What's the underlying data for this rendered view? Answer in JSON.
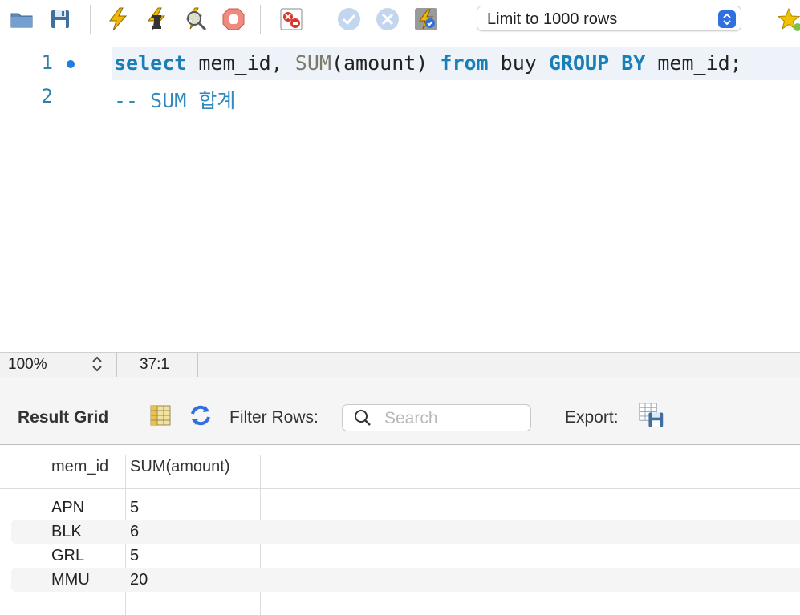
{
  "toolbar": {
    "icons": [
      "open-folder-icon",
      "save-icon",
      "execute-icon",
      "execute-current-icon",
      "explain-icon",
      "stop-icon",
      "toggle-error-icon",
      "commit-icon",
      "rollback-icon",
      "autocommit-icon",
      "beautify-icon"
    ],
    "limit_select": "Limit to 1000 rows"
  },
  "editor": {
    "lines": [
      {
        "number": "1"
      },
      {
        "number": "2"
      }
    ],
    "line1_tokens": [
      "select",
      " mem_id, ",
      "SUM",
      "(amount) ",
      "from",
      " buy ",
      "GROUP BY",
      " mem_id;"
    ],
    "line2_text": "-- SUM 합계"
  },
  "statusbar": {
    "zoom": "100%",
    "position": "37:1"
  },
  "result": {
    "tab_label": "Result Grid",
    "filter_label": "Filter Rows:",
    "search_placeholder": "Search",
    "export_label": "Export:",
    "columns": [
      "mem_id",
      "SUM(amount)"
    ],
    "rows": [
      [
        "APN",
        "5"
      ],
      [
        "BLK",
        "6"
      ],
      [
        "GRL",
        "5"
      ],
      [
        "MMU",
        "20"
      ]
    ]
  },
  "colors": {
    "keyword": "#1a7fb5",
    "comment": "#2f8ac0",
    "accent": "#2f6fe0"
  }
}
